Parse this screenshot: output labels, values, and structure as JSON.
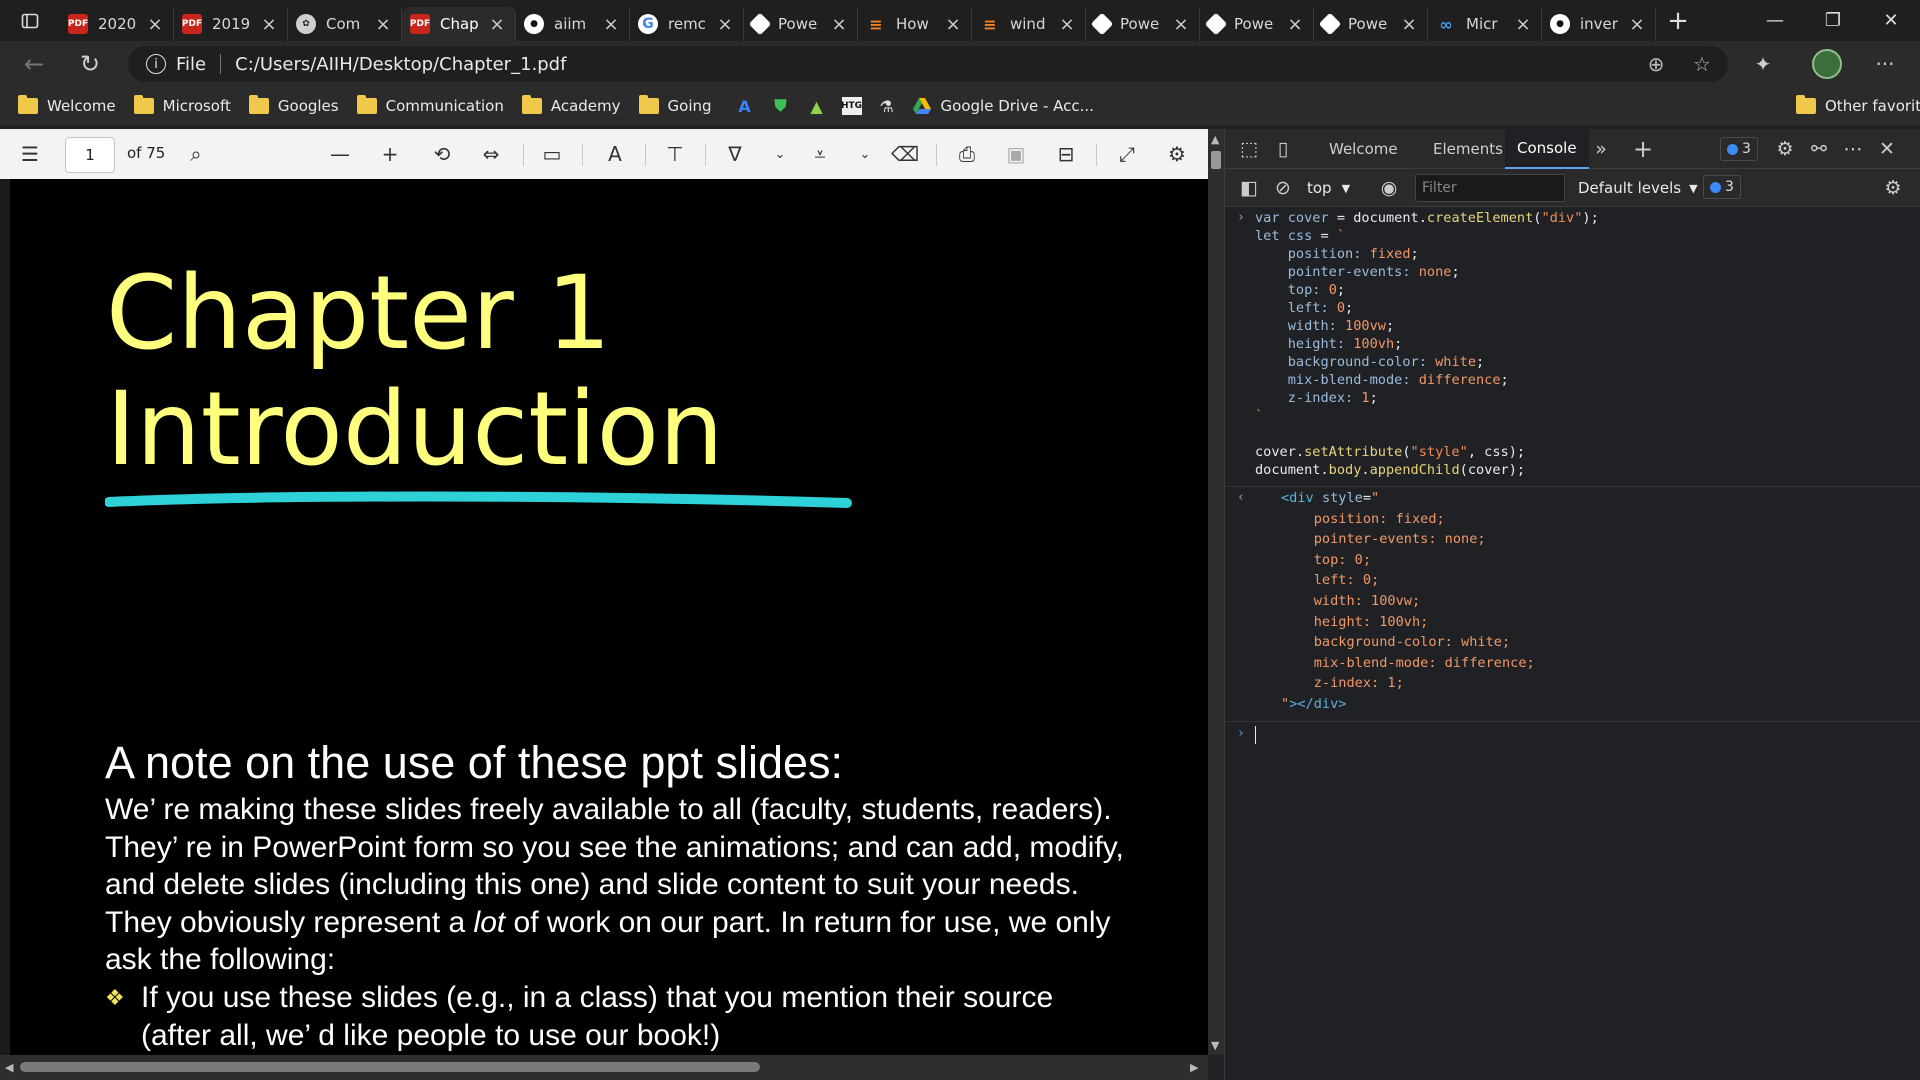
{
  "browser": {
    "tabs": [
      {
        "label": "2020",
        "icon": "pdf-icon",
        "active": false
      },
      {
        "label": "2019",
        "icon": "pdf-icon",
        "active": false
      },
      {
        "label": "Com",
        "icon": "chatgpt-icon",
        "active": false
      },
      {
        "label": "Chap",
        "icon": "pdf-icon",
        "active": true
      },
      {
        "label": "aiim",
        "icon": "github-icon",
        "active": false
      },
      {
        "label": "remc",
        "icon": "google-icon",
        "active": false
      },
      {
        "label": "Powe",
        "icon": "powershell-icon",
        "active": false
      },
      {
        "label": "How",
        "icon": "stackoverflow-icon",
        "active": false
      },
      {
        "label": "wind",
        "icon": "stackoverflow-icon",
        "active": false
      },
      {
        "label": "Powe",
        "icon": "powershell-icon",
        "active": false
      },
      {
        "label": "Powe",
        "icon": "powershell-icon",
        "active": false
      },
      {
        "label": "Powe",
        "icon": "powershell-icon",
        "active": false
      },
      {
        "label": "Micr",
        "icon": "microsoft-learn-icon",
        "active": false
      },
      {
        "label": "inver",
        "icon": "github-icon",
        "active": false
      }
    ],
    "address": {
      "scheme_label": "File",
      "url": "C:/Users/AIIH/Desktop/Chapter_1.pdf"
    },
    "bookmarks": [
      {
        "label": "Welcome",
        "icon": "folder-icon"
      },
      {
        "label": "Microsoft",
        "icon": "folder-icon"
      },
      {
        "label": "Googles",
        "icon": "folder-icon"
      },
      {
        "label": "Communication",
        "icon": "folder-icon"
      },
      {
        "label": "Academy",
        "icon": "folder-icon"
      },
      {
        "label": "Going",
        "icon": "folder-icon"
      }
    ],
    "bookmark_drive_label": "Google Drive - Acc...",
    "bookmark_htg_label": "HTG",
    "other_favorites": "Other favorites"
  },
  "pdf": {
    "page_current": "1",
    "page_total_label": "of 75",
    "slide": {
      "title_line1": "Chapter 1",
      "title_line2": "Introduction",
      "note_heading": "A note on the use of these ppt slides:",
      "note_lines": [
        "We’ re making these slides freely available to all (faculty, students, readers).",
        "They’ re in PowerPoint form so you see the animations; and can add, modify,",
        "and delete slides  (including this one) and slide content to suit your needs.",
        "They obviously represent a ",
        "lot",
        " of work on our part. In return for use, we only",
        "ask the following:"
      ],
      "bullet_lines": [
        "If you use these slides (e.g., in a class) that you mention their source",
        "(after all, we’ d like people to use our book!)"
      ]
    }
  },
  "devtools": {
    "tabs": [
      "Welcome",
      "Elements",
      "Console"
    ],
    "active_tab": "Console",
    "issues_count": "3",
    "context": "top",
    "filter_placeholder": "Filter",
    "levels_label": "Default levels",
    "levels_issues": "3",
    "input_lines": [
      "var cover = document.createElement(\"div\");",
      "let css = `",
      "    position: fixed;",
      "    pointer-events: none;",
      "    top: 0;",
      "    left: 0;",
      "    width: 100vw;",
      "    height: 100vh;",
      "    background-color: white;",
      "    mix-blend-mode: difference;",
      "    z-index: 1;",
      "`",
      "",
      "cover.setAttribute(\"style\", css);",
      "document.body.appendChild(cover);"
    ],
    "result_lines": [
      "<div style=\"",
      "    position: fixed;",
      "    pointer-events: none;",
      "    top: 0;",
      "    left: 0;",
      "    width: 100vw;",
      "    height: 100vh;",
      "    background-color: white;",
      "    mix-blend-mode: difference;",
      "    z-index: 1;",
      "\"></div>"
    ]
  }
}
